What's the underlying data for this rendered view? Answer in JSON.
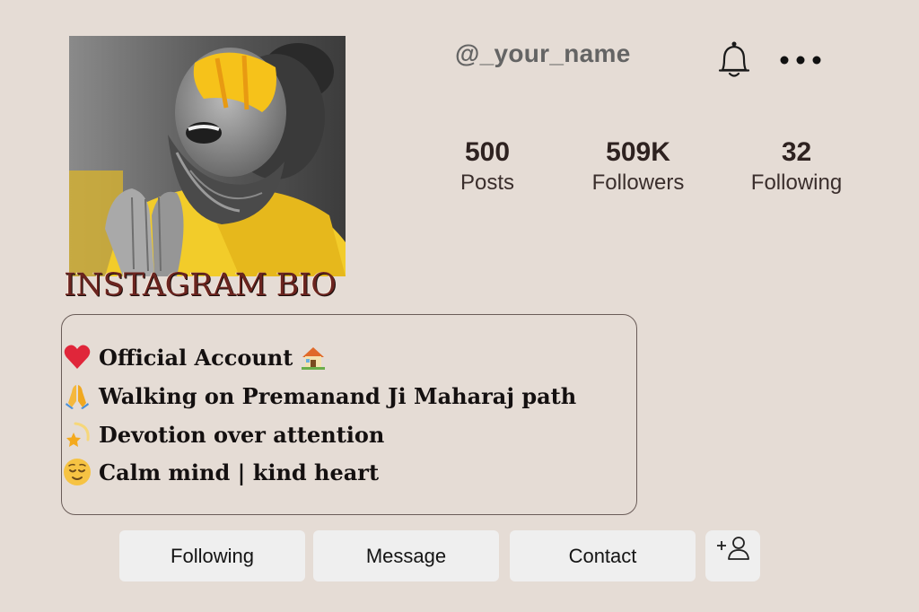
{
  "profile": {
    "username": "@_your_name",
    "photo_alt": "profile-photo"
  },
  "header": {
    "bell_icon": "bell-icon",
    "more_icon": "more-horizontal-icon"
  },
  "stats": [
    {
      "value": "500",
      "label": "Posts"
    },
    {
      "value": "509K",
      "label": "Followers"
    },
    {
      "value": "32",
      "label": "Following"
    }
  ],
  "bio": {
    "heading": "INSTAGRAM BIO",
    "lines": [
      {
        "icon": "red-heart-icon",
        "text": "Official Account",
        "trailing_icon": "house-icon"
      },
      {
        "icon": "folded-hands-icon",
        "text": "Walking on Premanand Ji Maharaj path"
      },
      {
        "icon": "dizzy-star-icon",
        "text": "Devotion over attention"
      },
      {
        "icon": "relieved-face-icon",
        "text": "Calm mind | kind heart"
      }
    ]
  },
  "actions": {
    "following_label": "Following",
    "message_label": "Message",
    "contact_label": "Contact",
    "add_icon": "add-person-icon"
  },
  "colors": {
    "background": "#e5dcd5",
    "button_bg": "#efefef",
    "heading": "#6b241f",
    "stat_text": "#2e2220"
  }
}
